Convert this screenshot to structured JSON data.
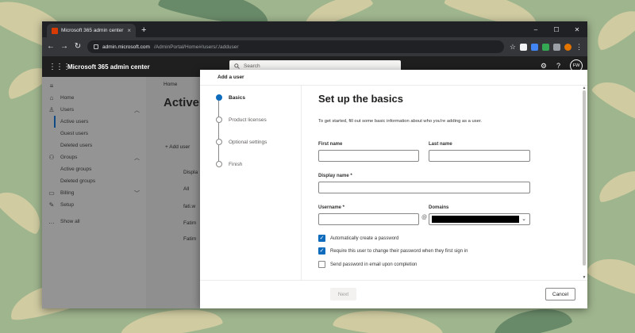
{
  "browser": {
    "tab_title": "Microsoft 365 admin center - Ac",
    "tab_close": "×",
    "new_tab": "+",
    "window_controls": [
      "–",
      "☐",
      "✕"
    ],
    "url_host": "admin.microsoft.com",
    "url_path": "/AdminPortal/Home#/users/:/adduser",
    "nav": {
      "back": "←",
      "forward": "→",
      "reload": "↻"
    },
    "star": "☆",
    "menu": "⋮"
  },
  "app": {
    "waffle": "⋮⋮⋮",
    "name": "Microsoft 365 admin center",
    "search_placeholder": "Search",
    "settings_icon": "⚙",
    "help_icon": "?",
    "avatar_initials": "FW"
  },
  "sidenav": {
    "collapse": "≡",
    "home": "Home",
    "users": "Users",
    "users_items": [
      "Active users",
      "Guest users",
      "Deleted users"
    ],
    "groups": "Groups",
    "groups_items": [
      "Active groups",
      "Deleted groups"
    ],
    "billing": "Billing",
    "setup": "Setup",
    "show_all": "Show all"
  },
  "background_page": {
    "breadcrumb": "Home",
    "title": "Active u",
    "add_user": "+ Add user",
    "rows": [
      "Displa",
      "All",
      "fati.w",
      "Fatim",
      "Fatim"
    ]
  },
  "panel": {
    "header": "Add a user",
    "steps": [
      "Basics",
      "Product licenses",
      "Optional settings",
      "Finish"
    ],
    "form": {
      "title": "Set up the basics",
      "description": "To get started, fill out some basic information about who you're adding as a user.",
      "first_name_label": "First name",
      "last_name_label": "Last name",
      "display_name_label": "Display name *",
      "username_label": "Username *",
      "domains_label": "Domains",
      "at_sign": "@",
      "first_name_value": "",
      "last_name_value": "",
      "display_name_value": "",
      "username_value": "",
      "checkboxes": [
        {
          "label": "Automatically create a password",
          "checked": true
        },
        {
          "label": "Require this user to change their password when they first sign in",
          "checked": true
        },
        {
          "label": "Send password in email upon completion",
          "checked": false
        }
      ]
    },
    "footer": {
      "next": "Next",
      "cancel": "Cancel"
    }
  }
}
